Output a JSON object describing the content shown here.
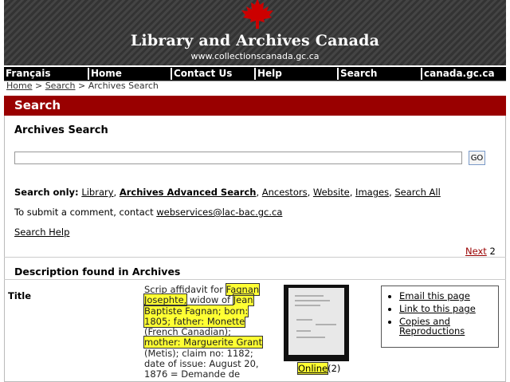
{
  "header": {
    "title": "Library and Archives Canada",
    "url": "www.collectionscanada.gc.ca"
  },
  "nav": {
    "items": [
      "Français",
      "Home",
      "Contact Us",
      "Help",
      "Search",
      "canada.gc.ca"
    ]
  },
  "breadcrumb": {
    "home": "Home",
    "sep1": " > ",
    "search": "Search",
    "sep2": " > ",
    "current": "Archives Search"
  },
  "search_section": {
    "bar_title": "Search",
    "heading": "Archives Search",
    "input_value": "",
    "go_label": "GO",
    "search_only_label": "Search only:",
    "search_only_links": [
      "Library",
      "Archives Advanced Search",
      "Ancestors",
      "Website",
      "Images",
      "Search All"
    ],
    "comment_text": "To submit a comment, contact ",
    "comment_email": "webservices@lac-bac.gc.ca",
    "help_link": "Search Help"
  },
  "results": {
    "next_label": "Next",
    "page_number": "2",
    "heading": "Description found in Archives",
    "field_label": "Title",
    "desc_parts": [
      "Scrip affidavit for ",
      "Fagnan Josephte,",
      " widow of ",
      "Jean Baptiste Fagnan; born: 1805; father: Monette",
      " (French Canadian); ",
      "mother: Marguerite Grant",
      " (Metis); claim no: 1182; date of issue: August 20, 1876 = Demande de"
    ],
    "online_label": "Online",
    "online_count": "(2)",
    "actions": [
      "Email this page",
      "Link to this page",
      "Copies and Reproductions"
    ]
  },
  "colors": {
    "search_bar": "#990000",
    "highlight": "#ffff33",
    "leaf": "#cc0000"
  }
}
